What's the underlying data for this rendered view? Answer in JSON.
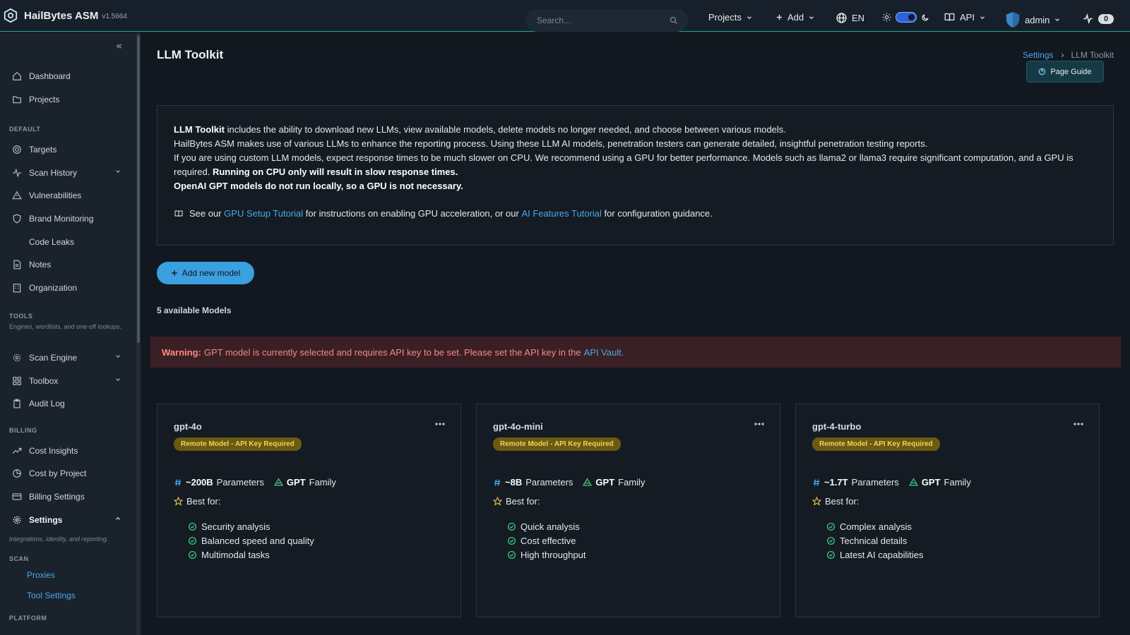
{
  "app": {
    "name": "HailBytes ASM",
    "version": "v1.5664"
  },
  "topbar": {
    "search_placeholder": "Search...",
    "projects": "Projects",
    "add": "Add",
    "language": "EN",
    "api": "API",
    "user": "admin",
    "activity_count": "0"
  },
  "sidebar": {
    "items": [
      {
        "label": "Dashboard"
      },
      {
        "label": "Projects"
      },
      {
        "label": "Targets"
      },
      {
        "label": "Scan History"
      },
      {
        "label": "Vulnerabilities"
      },
      {
        "label": "Brand Monitoring"
      },
      {
        "label": "Code Leaks"
      },
      {
        "label": "Notes"
      },
      {
        "label": "Organization"
      },
      {
        "label": "Scan Engine"
      },
      {
        "label": "Toolbox"
      },
      {
        "label": "Audit Log"
      },
      {
        "label": "Cost Insights"
      },
      {
        "label": "Cost by Project"
      },
      {
        "label": "Billing Settings"
      },
      {
        "label": "Settings"
      }
    ],
    "sections": {
      "default": "DEFAULT",
      "tools": "TOOLS",
      "tools_desc": "Engines, wordlists, and one-off lookups.",
      "billing": "BILLING",
      "settings_desc": "Integrations, identity, and reporting.",
      "scan": "SCAN",
      "platform": "PLATFORM"
    },
    "sub_items": [
      {
        "label": "Proxies"
      },
      {
        "label": "Tool Settings"
      }
    ]
  },
  "page": {
    "title": "LLM Toolkit",
    "breadcrumb": {
      "parent": "Settings",
      "current": "LLM Toolkit"
    },
    "page_guide": "Page Guide"
  },
  "info": {
    "l1_bold": "LLM Toolkit",
    "l1_rest": " includes the ability to download new LLMs, view available models, delete models no longer needed, and choose between various models.",
    "l2": "HailBytes ASM makes use of various LLMs to enhance the reporting process. Using these LLM AI models, penetration testers can generate detailed, insightful penetration testing reports.",
    "l3": "If you are using custom LLM models, expect response times to be much slower on CPU. We recommend using a GPU for better performance. Models such as llama2 or llama3 require significant computation, and a GPU is required.",
    "l3_bold": "Running on CPU only will result in slow response times.",
    "l4_bold": "OpenAI GPT models do not run locally, so a GPU is not necessary.",
    "see_prefix": "See our",
    "gpu_link": "GPU Setup Tutorial",
    "see_mid": "for instructions on enabling GPU acceleration, or our",
    "ai_link": "AI Features Tutorial",
    "see_suffix": "for configuration guidance."
  },
  "add_button": "Add new model",
  "model_count": "5 available Models",
  "warning": {
    "label": "Warning:",
    "text": "GPT model is currently selected and requires API key to be set. Please set the API key in the",
    "link": "API Vault."
  },
  "models": [
    {
      "name": "gpt-4o",
      "badge": "Remote Model - API Key Required",
      "params_value": "~200B",
      "params_label": "Parameters",
      "family_value": "GPT",
      "family_label": "Family",
      "best_for_label": "Best for:",
      "uses": [
        "Security analysis",
        "Balanced speed and quality",
        "Multimodal tasks"
      ]
    },
    {
      "name": "gpt-4o-mini",
      "badge": "Remote Model - API Key Required",
      "params_value": "~8B",
      "params_label": "Parameters",
      "family_value": "GPT",
      "family_label": "Family",
      "best_for_label": "Best for:",
      "uses": [
        "Quick analysis",
        "Cost effective",
        "High throughput"
      ]
    },
    {
      "name": "gpt-4-turbo",
      "badge": "Remote Model - API Key Required",
      "params_value": "~1.7T",
      "params_label": "Parameters",
      "family_value": "GPT",
      "family_label": "Family",
      "best_for_label": "Best for:",
      "uses": [
        "Complex analysis",
        "Technical details",
        "Latest AI capabilities"
      ]
    }
  ],
  "colors": {
    "accent": "#1fa89a",
    "link": "#4aa8e8",
    "warning_bg": "#3a1f24",
    "badge_bg": "#6b5a12"
  }
}
